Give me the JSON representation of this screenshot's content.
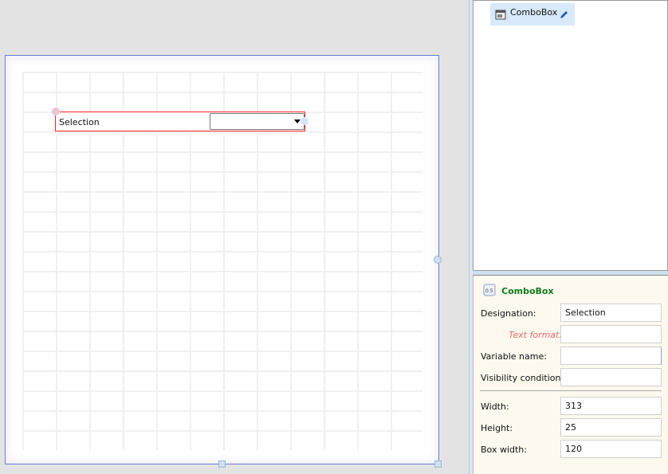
{
  "canvas": {
    "combobox": {
      "label": "Selection",
      "selected": ""
    }
  },
  "tree": {
    "item_label": "ComboBox"
  },
  "properties": {
    "title": "ComboBox",
    "fields": [
      {
        "label": "Designation:",
        "value": "Selection"
      },
      {
        "label": "Text format:",
        "value": ""
      },
      {
        "label": "Variable name:",
        "value": ""
      },
      {
        "label": "Visibility condition:",
        "value": ""
      },
      {
        "label": "Width:",
        "value": "313"
      },
      {
        "label": "Height:",
        "value": "25"
      },
      {
        "label": "Box width:",
        "value": "120"
      }
    ]
  },
  "colors": {
    "selection": "#ff2222",
    "accent": "#117a1d",
    "form_border": "#6a7fd6"
  }
}
